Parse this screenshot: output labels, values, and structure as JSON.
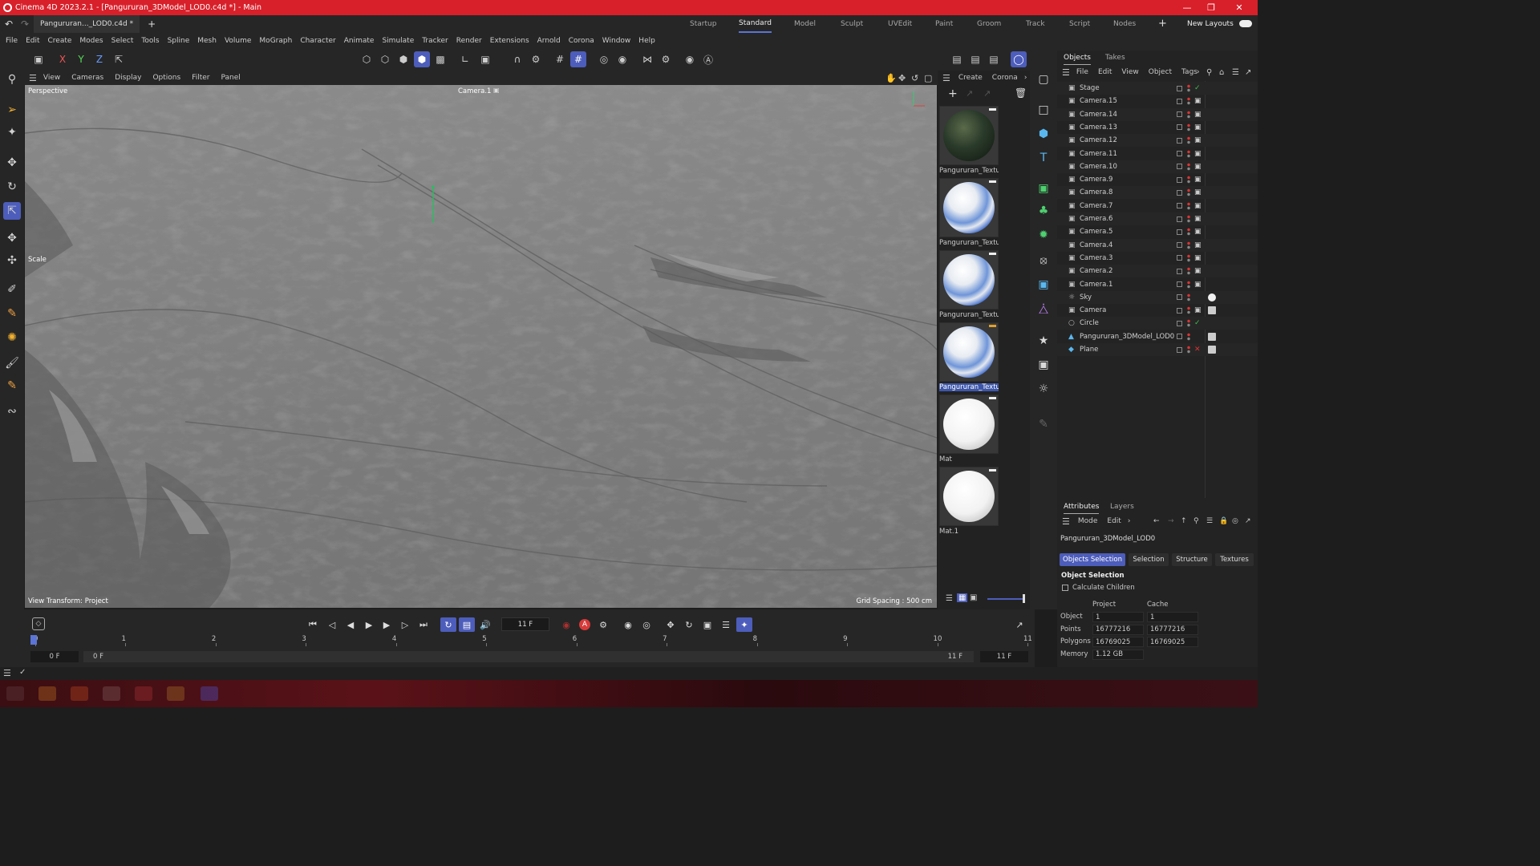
{
  "window": {
    "title": "Cinema 4D 2023.2.1 - [Pangururan_3DModel_LOD0.c4d *] - Main",
    "min_icon": "minimize-icon",
    "max_icon": "restore-icon",
    "close_icon": "close-icon"
  },
  "doc_tab": {
    "label": "Pangururan..._LOD0.c4d *",
    "add": "+"
  },
  "layouts": {
    "items": [
      "Startup",
      "Standard",
      "Model",
      "Sculpt",
      "UVEdit",
      "Paint",
      "Groom",
      "Track",
      "Script",
      "Nodes"
    ],
    "active": "Standard",
    "add": "+",
    "new_layouts": "New Layouts"
  },
  "menu": [
    "File",
    "Edit",
    "Create",
    "Modes",
    "Select",
    "Tools",
    "Spline",
    "Mesh",
    "Volume",
    "MoGraph",
    "Character",
    "Animate",
    "Simulate",
    "Tracker",
    "Render",
    "Extensions",
    "Arnold",
    "Corona",
    "Window",
    "Help"
  ],
  "axis_toggles": [
    "X",
    "Y",
    "Z"
  ],
  "viewport": {
    "menu": [
      "View",
      "Cameras",
      "Display",
      "Options",
      "Filter",
      "Panel"
    ],
    "projection": "Perspective",
    "camera": "Camera.1",
    "tool_label": "Scale",
    "view_transform": "View Transform: Project",
    "grid_spacing": "Grid Spacing : 500 cm"
  },
  "materials": {
    "menu": [
      "Create",
      "Corona"
    ],
    "items": [
      {
        "name": "Pangururan_Textu",
        "style": "terrain"
      },
      {
        "name": "Pangururan_Textu",
        "style": "blue-white"
      },
      {
        "name": "Pangururan_Textu",
        "style": "blue-white"
      },
      {
        "name": "Pangururan_Textu",
        "style": "blue-white",
        "selected": true
      },
      {
        "name": "Mat",
        "style": "white"
      },
      {
        "name": "Mat.1",
        "style": "white"
      }
    ]
  },
  "objects": {
    "tabs": [
      "Objects",
      "Takes"
    ],
    "menu": [
      "File",
      "Edit",
      "View",
      "Object",
      "Tags"
    ],
    "items": [
      {
        "name": "Stage",
        "icon": "stage-icon"
      },
      {
        "name": "Camera.15",
        "icon": "camera-icon"
      },
      {
        "name": "Camera.14",
        "icon": "camera-icon"
      },
      {
        "name": "Camera.13",
        "icon": "camera-icon"
      },
      {
        "name": "Camera.12",
        "icon": "camera-icon"
      },
      {
        "name": "Camera.11",
        "icon": "camera-icon"
      },
      {
        "name": "Camera.10",
        "icon": "camera-icon"
      },
      {
        "name": "Camera.9",
        "icon": "camera-icon"
      },
      {
        "name": "Camera.8",
        "icon": "camera-icon"
      },
      {
        "name": "Camera.7",
        "icon": "camera-icon"
      },
      {
        "name": "Camera.6",
        "icon": "camera-icon"
      },
      {
        "name": "Camera.5",
        "icon": "camera-icon"
      },
      {
        "name": "Camera.4",
        "icon": "camera-icon"
      },
      {
        "name": "Camera.3",
        "icon": "camera-icon"
      },
      {
        "name": "Camera.2",
        "icon": "camera-icon"
      },
      {
        "name": "Camera.1",
        "icon": "camera-icon"
      },
      {
        "name": "Sky",
        "icon": "sky-icon"
      },
      {
        "name": "Camera",
        "icon": "camera-icon"
      },
      {
        "name": "Circle",
        "icon": "circle-spline-icon"
      },
      {
        "name": "Pangururan_3DModel_LOD0",
        "icon": "polygon-object-icon"
      },
      {
        "name": "Plane",
        "icon": "plane-icon"
      }
    ]
  },
  "attributes": {
    "tabs": [
      "Attributes",
      "Layers"
    ],
    "menu": [
      "Mode",
      "Edit"
    ],
    "object_name": "Pangururan_3DModel_LOD0",
    "subtabs": [
      "Objects Selection",
      "Selection",
      "Structure",
      "Textures"
    ],
    "active_subtab": "Objects Selection",
    "section": "Object Selection",
    "calc_children": "Calculate Children",
    "col_project": "Project",
    "col_cache": "Cache",
    "rows": [
      {
        "label": "Object",
        "project": "1",
        "cache": "1"
      },
      {
        "label": "Points",
        "project": "16777216",
        "cache": "16777216"
      },
      {
        "label": "Polygons",
        "project": "16769025",
        "cache": "16769025"
      },
      {
        "label": "Memory",
        "project": "1.12 GB",
        "cache": ""
      }
    ]
  },
  "timeline": {
    "current_frame": "11 F",
    "ticks": [
      "0",
      "1",
      "2",
      "3",
      "4",
      "5",
      "6",
      "7",
      "8",
      "9",
      "10",
      "11"
    ],
    "start": "0 F",
    "min": "0 F",
    "max": "11 F",
    "end": "11 F"
  },
  "colors": {
    "accent": "#4d5dbb",
    "title_bar": "#d8202a",
    "ok_check": "#3fbf4f",
    "error_x": "#e03030"
  }
}
